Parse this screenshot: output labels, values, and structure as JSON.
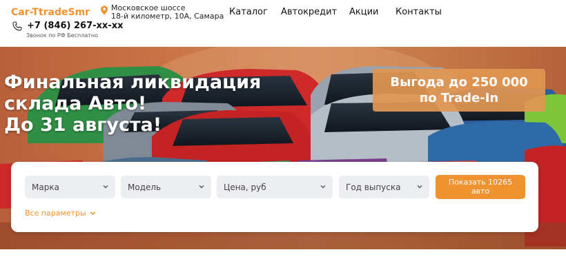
{
  "header": {
    "logo": "Car-TtradeSmr",
    "address_line1": "Московское шоссе",
    "address_line2": "18-й километр, 10А, Самара",
    "phone": "+7 (846) 267-xx-xx",
    "phone_note": "Звонок по РФ Бесплатно",
    "nav": [
      "Каталог",
      "Автокредит",
      "Акции",
      "Контакты"
    ]
  },
  "hero": {
    "title_line1": "Финальная ликвидация",
    "title_line2": "склада Авто!",
    "title_line3": "До 31 августа!",
    "promo_line1": "Выгода до 250 000",
    "promo_line2": "по Trade-In"
  },
  "filters": {
    "brand": "Марка",
    "model": "Модель",
    "price": "Цена, руб",
    "year": "Год выпуска",
    "show_line1": "Показать 10265",
    "show_line2": "авто",
    "all_params": "Все параметры"
  },
  "colors": {
    "accent": "#f0922f",
    "hero_bg": "#c97447",
    "select_bg": "#eceef2"
  },
  "icons": [
    "location-pin-icon",
    "phone-icon",
    "chevron-down-icon"
  ]
}
